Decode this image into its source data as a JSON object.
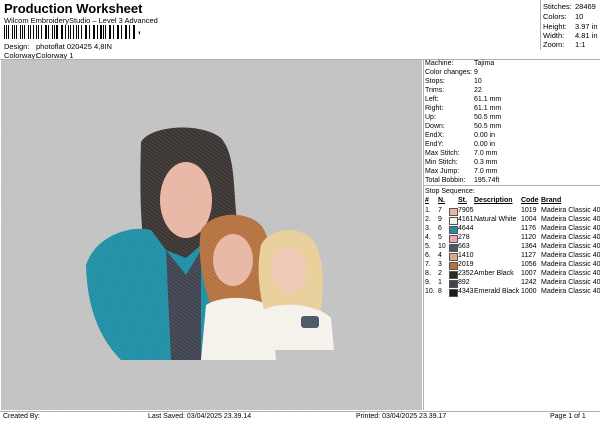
{
  "header": {
    "title": "Production Worksheet",
    "subtitle": "Wilcom EmbroideryStudio – Level 3 Advanced",
    "barcode_text": ",",
    "design_label": "Design:",
    "design_value": "photoflat 020425 4,8IN",
    "colorway_label": "Colorway:",
    "colorway_value": "Colorway 1"
  },
  "summary": {
    "stitches_label": "Stitches:",
    "stitches": "28469",
    "colors_label": "Colors:",
    "colors": "10",
    "height_label": "Height:",
    "height": "3.97 in",
    "width_label": "Width:",
    "width": "4.81 in",
    "zoom_label": "Zoom:",
    "zoom": "1:1"
  },
  "machine": [
    {
      "label": "Machine:",
      "value": "Tajima"
    },
    {
      "label": "Color changes:",
      "value": "9"
    },
    {
      "label": "Stops:",
      "value": "10"
    },
    {
      "label": "Trims:",
      "value": "22"
    },
    {
      "label": "Left:",
      "value": "61.1 mm"
    },
    {
      "label": "Right:",
      "value": "61.1 mm"
    },
    {
      "label": "Up:",
      "value": "50.5 mm"
    },
    {
      "label": "Down:",
      "value": "50.5 mm"
    },
    {
      "label": "EndX:",
      "value": "0.00 in"
    },
    {
      "label": "EndY:",
      "value": "0.00 in"
    },
    {
      "label": "Max Stitch:",
      "value": "7.0 mm"
    },
    {
      "label": "Min Stitch:",
      "value": "0.3 mm"
    },
    {
      "label": "Max Jump:",
      "value": "7.0 mm"
    },
    {
      "label": "Total Bobbin:",
      "value": "195.74ft"
    }
  ],
  "stop_sequence": {
    "title": "Stop Sequence:",
    "headers": {
      "num": "#",
      "n": "N.",
      "st": "St.",
      "desc": "Description",
      "code": "Code",
      "brand": "Brand"
    },
    "rows": [
      {
        "num": "1.",
        "n": "7",
        "color": "#e8b6a4",
        "st": "7905",
        "desc": "",
        "code": "1019",
        "brand": "Madeira Classic 40"
      },
      {
        "num": "2.",
        "n": "9",
        "color": "#f4f2ea",
        "st": "4161",
        "desc": "Natural White",
        "code": "1004",
        "brand": "Madeira Classic 40"
      },
      {
        "num": "3.",
        "n": "6",
        "color": "#1f8fa6",
        "st": "4644",
        "desc": "",
        "code": "1176",
        "brand": "Madeira Classic 40"
      },
      {
        "num": "4.",
        "n": "5",
        "color": "#f0a6b4",
        "st": "278",
        "desc": "",
        "code": "1120",
        "brand": "Madeira Classic 40"
      },
      {
        "num": "5.",
        "n": "10",
        "color": "#4a5666",
        "st": "663",
        "desc": "",
        "code": "1364",
        "brand": "Madeira Classic 40"
      },
      {
        "num": "6.",
        "n": "4",
        "color": "#d9aa88",
        "st": "1410",
        "desc": "",
        "code": "1127",
        "brand": "Madeira Classic 40"
      },
      {
        "num": "7.",
        "n": "3",
        "color": "#b5723f",
        "st": "2019",
        "desc": "",
        "code": "1056",
        "brand": "Madeira Classic 40"
      },
      {
        "num": "8.",
        "n": "2",
        "color": "#2e2a28",
        "st": "2352",
        "desc": "Amber Black",
        "code": "1007",
        "brand": "Madeira Classic 40"
      },
      {
        "num": "9.",
        "n": "1",
        "color": "#3f4450",
        "st": "892",
        "desc": "",
        "code": "1242",
        "brand": "Madeira Classic 40"
      },
      {
        "num": "10.",
        "n": "8",
        "color": "#1c1c1c",
        "st": "4343",
        "desc": "Emerald Black",
        "code": "1000",
        "brand": "Madeira Classic 40"
      }
    ]
  },
  "footer": {
    "created_by": "Created By:",
    "last_saved": "Last Saved: 03/04/2025 23.39.14",
    "printed": "Printed: 03/04/2025 23.39.17",
    "page": "Page 1 of 1"
  },
  "colors": {
    "canvas_bg": "#c2c2c2",
    "divider": "#b0b0b0"
  }
}
